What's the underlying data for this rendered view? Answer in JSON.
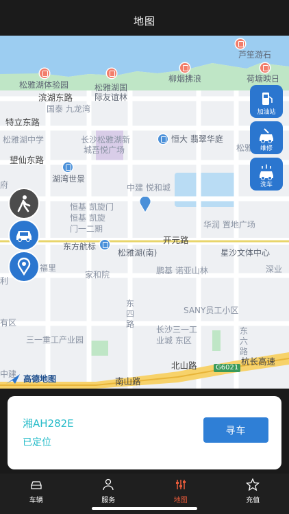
{
  "header": {
    "title": "地图"
  },
  "map": {
    "labels": {
      "lugu": "芦笙游石",
      "songyahu_park": "松雅湖体验园",
      "songyahu_intl": "松雅湖国",
      "songyahu_intl2": "际友谊林",
      "liuyan": "柳烟拂浪",
      "hetang": "荷塘映日",
      "binhu_east": "滨湖东路",
      "guotai": "国泰 九龙湾",
      "teli_east": "特立东路",
      "songyahu_school": "松雅湖中学",
      "changsha_songyahu": "长沙松雅湖新",
      "cheng_wuyue": "城吾悦广场",
      "hengda": "恒大 翡翠华庭",
      "song_right": "松雅",
      "wangxian_east": "望仙东路",
      "huwan": "湖湾世景",
      "zhongjian": "中建 悦和城",
      "fu": "府",
      "hengji_kaixuan": "恒基 凯旋门",
      "hengji_kaixuan2": "恒基 凯旋",
      "hengji_kaixuan3": "门一二期",
      "huarun": "华润 置地广场",
      "dongfang": "东方航标",
      "kaiyuan": "开元路",
      "songyahu_south": "松雅湖(南)",
      "xingsha_culture": "星沙文体中心",
      "jiahe": "家和院",
      "pengji": "鹏基 诺亚山林",
      "shenye": "深业",
      "sany": "SANY员工小区",
      "dongsi_1": "东",
      "dongsi_2": "四",
      "dongsi_3": "路",
      "cs_sanyi": "长沙三一工",
      "cs_sanyi2": "业城 东区",
      "sanyi_heavy": "三一重工产业园",
      "dongliu_1": "东",
      "dongliu_2": "六",
      "dongliu_3": "路",
      "beishan": "北山路",
      "hangchang": "杭长高速",
      "g6021": "G6021",
      "nanshan": "南山路",
      "zhongjian_left": "中建",
      "youqu": "有区",
      "guanli": "利",
      "fuli": "福里"
    },
    "side_buttons": {
      "gas": "加油站",
      "repair": "维修",
      "wash": "洗车"
    },
    "logo": "高德地图"
  },
  "vehicle_card": {
    "plate": "湘AH282E",
    "status": "已定位",
    "find_label": "寻车"
  },
  "tabbar": {
    "items": [
      {
        "label": "车辆"
      },
      {
        "label": "服务"
      },
      {
        "label": "地图"
      },
      {
        "label": "充值"
      }
    ]
  },
  "colors": {
    "accent": "#2f7fd6",
    "teal_text": "#27bcc9",
    "active_tab": "#e55a3a",
    "water": "#9ccdf1",
    "highway": "#f5c542"
  }
}
